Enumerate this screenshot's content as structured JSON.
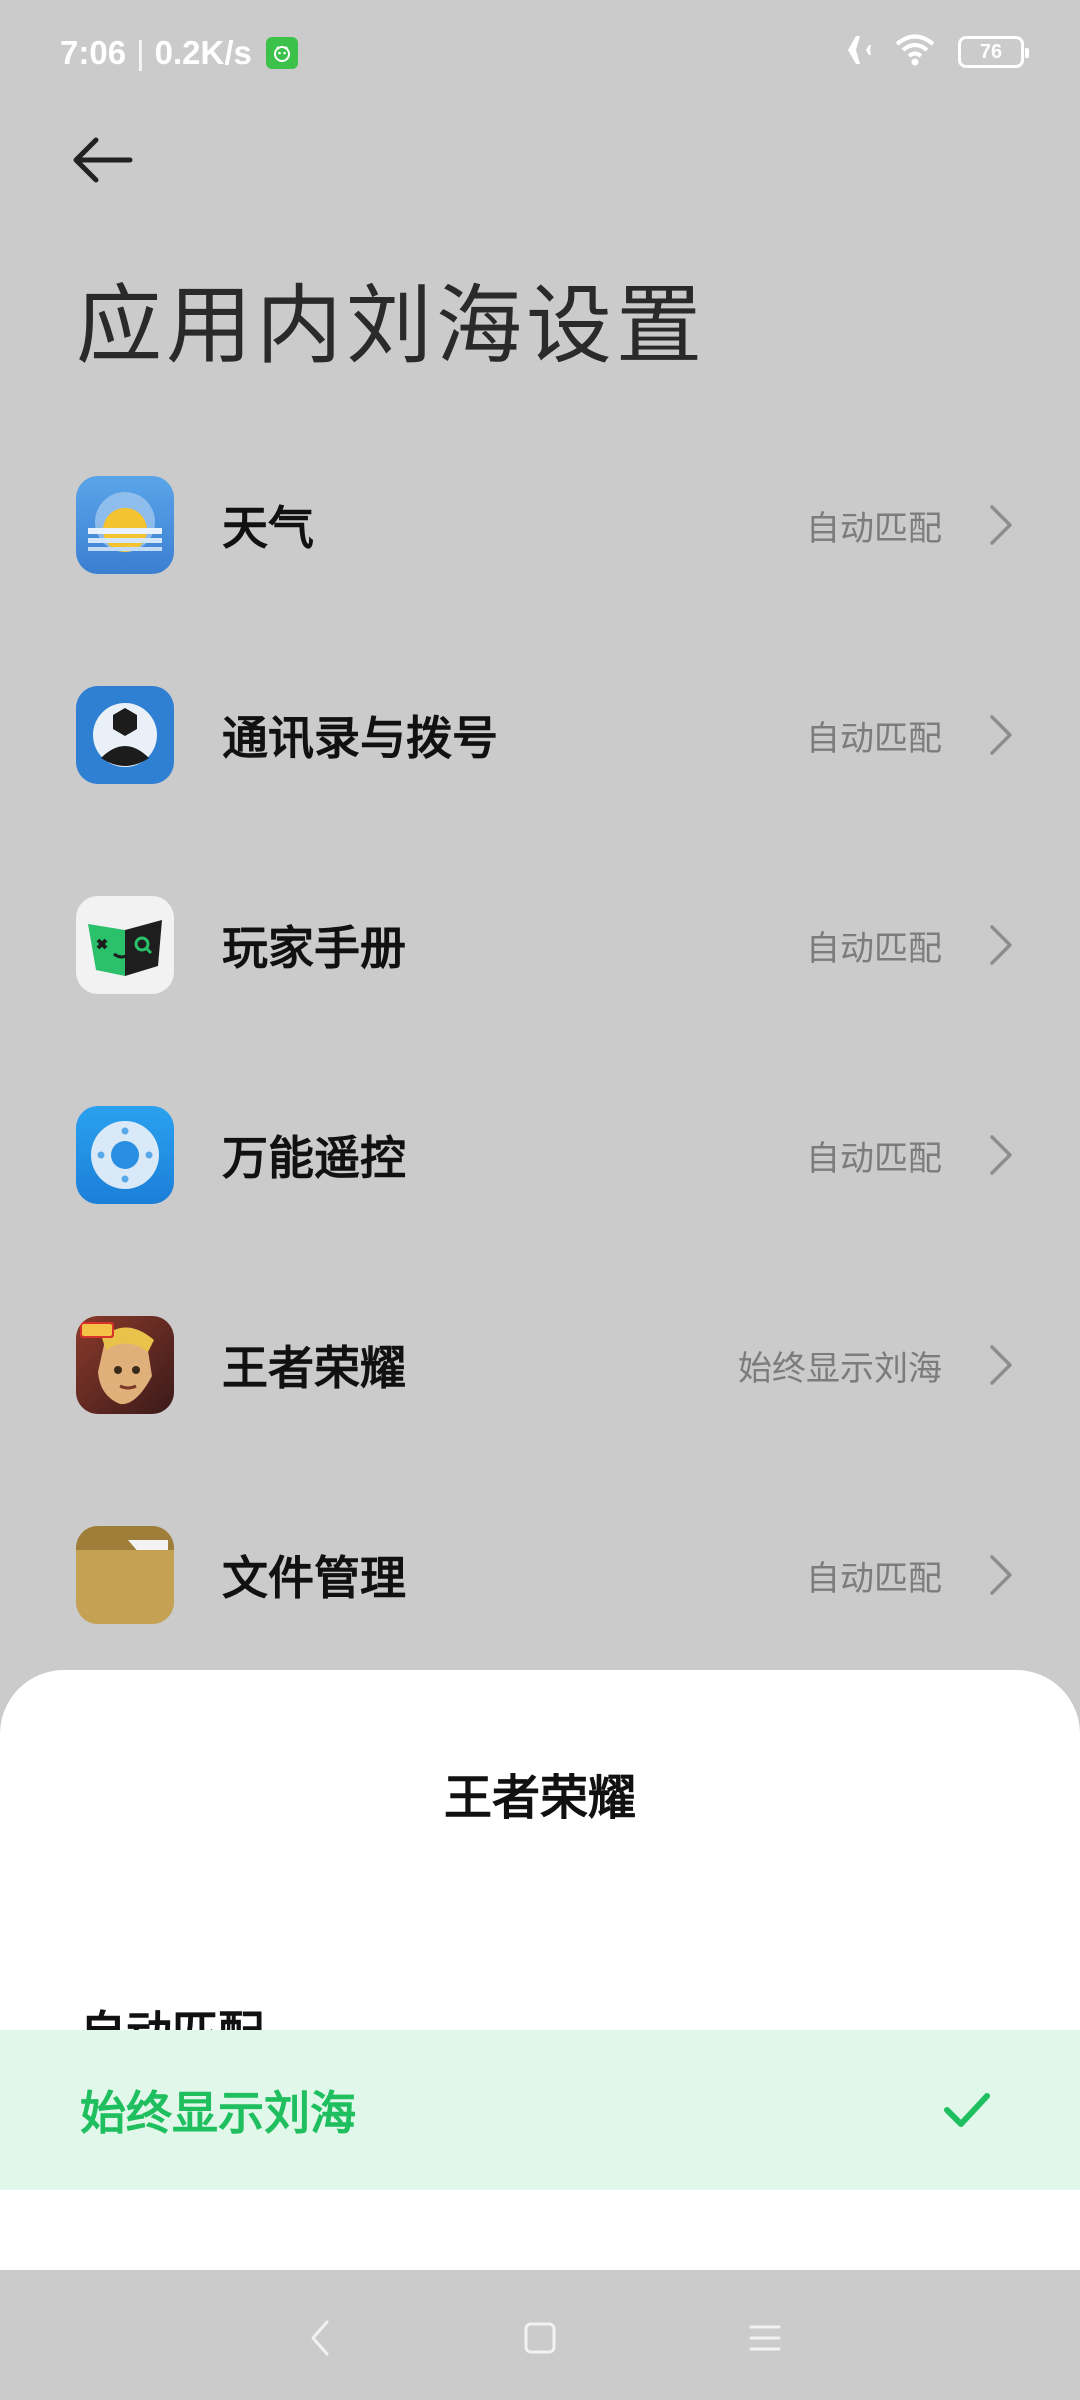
{
  "status_bar": {
    "time": "7:06",
    "separator": "|",
    "speed": "0.2K/s",
    "battery": "76"
  },
  "header": {
    "title": "应用内刘海设置"
  },
  "apps": [
    {
      "name": "天气",
      "value": "自动匹配",
      "icon": "weather-icon"
    },
    {
      "name": "通讯录与拨号",
      "value": "自动匹配",
      "icon": "contacts-icon"
    },
    {
      "name": "玩家手册",
      "value": "自动匹配",
      "icon": "player-handbook-icon"
    },
    {
      "name": "万能遥控",
      "value": "自动匹配",
      "icon": "remote-control-icon"
    },
    {
      "name": "王者荣耀",
      "value": "始终显示刘海",
      "icon": "honor-of-kings-icon"
    },
    {
      "name": "文件管理",
      "value": "自动匹配",
      "icon": "file-manager-icon"
    }
  ],
  "sheet": {
    "title": "王者荣耀",
    "options": [
      {
        "label": "自动匹配",
        "selected": false
      },
      {
        "label": "始终显示刘海",
        "selected": true
      }
    ]
  },
  "colors": {
    "accent": "#1fbf5f",
    "selected_bg": "#e1f7ea",
    "dim_bg": "#cbcbcb"
  }
}
